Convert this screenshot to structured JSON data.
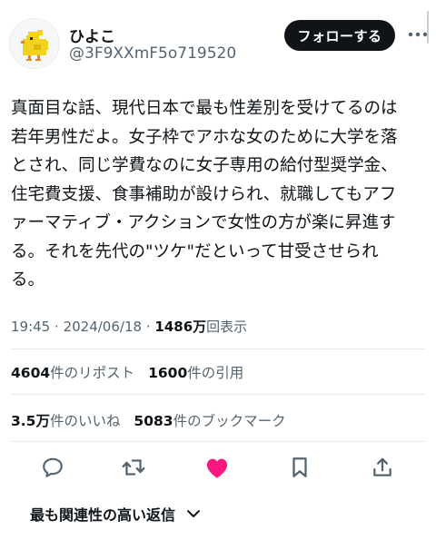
{
  "author": {
    "display_name": "ひよこ",
    "handle": "@3F9XXmF5o719520",
    "avatar_icon": "chick-pixel-icon"
  },
  "header": {
    "follow_label": "フォローする",
    "more_icon": "more-dots-icon"
  },
  "tweet": {
    "lines": [
      "真面目な話、現代日本で最も性差別を受けてるのは",
      "若年男性だよ。女子枠でアホな女のために大学を落",
      "とされ、同じ学費なのに女子専用の給付型奨学金、",
      "住宅費支援、食事補助が設けられ、就職してもアフ",
      "ァーマティブ・アクションで女性の方が楽に昇進す",
      "る。それを先代の\"ツケ\"だといって甘受させられ",
      "る。"
    ]
  },
  "meta": {
    "time": "19:45",
    "separator": "·",
    "date": "2024/06/18",
    "dot": "·",
    "views_count": "1486万",
    "views_label": "回表示"
  },
  "stats": {
    "reposts_count": "4604",
    "reposts_label": "件のリポスト",
    "quotes_count": "1600",
    "quotes_label": "件の引用",
    "likes_count": "3.5万",
    "likes_label": "件のいいね",
    "bookmarks_count": "5083",
    "bookmarks_label": "件のブックマーク"
  },
  "actions": {
    "reply_icon": "reply-icon",
    "repost_icon": "repost-icon",
    "like_icon": "heart-icon",
    "bookmark_icon": "bookmark-icon",
    "share_icon": "share-icon",
    "like_color": "#f91880",
    "icon_color": "#536471"
  },
  "replies_sort": {
    "label": "最も関連性の高い返信"
  }
}
